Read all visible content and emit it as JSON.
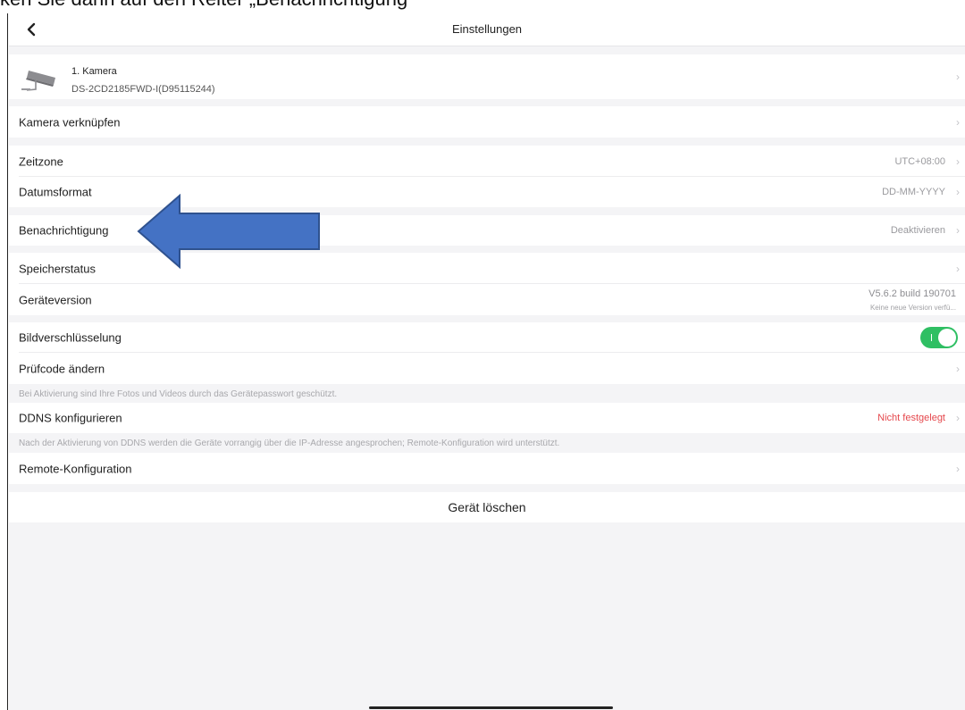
{
  "doc_caption": "ken Sie dann auf den Reiter „Benachrichtigung",
  "header": {
    "title": "Einstellungen"
  },
  "camera": {
    "name": "1. Kamera",
    "serial": "DS-2CD2185FWD-I(D95115244)"
  },
  "rows": {
    "link_camera": {
      "label": "Kamera verknüpfen"
    },
    "timezone": {
      "label": "Zeitzone",
      "value": "UTC+08:00"
    },
    "date_format": {
      "label": "Datumsformat",
      "value": "DD-MM-YYYY"
    },
    "notification": {
      "label": "Benachrichtigung",
      "value": "Deaktivieren"
    },
    "storage": {
      "label": "Speicherstatus"
    },
    "version": {
      "label": "Geräteversion",
      "value": "V5.6.2 build 190701",
      "sub": "Keine neue Version verfü..."
    },
    "encryption": {
      "label": "Bildverschlüsselung",
      "enabled": true
    },
    "verify_code": {
      "label": "Prüfcode ändern"
    },
    "ddns": {
      "label": "DDNS konfigurieren",
      "value": "Nicht festgelegt"
    },
    "remote": {
      "label": "Remote-Konfiguration"
    }
  },
  "notes": {
    "encryption": "Bei Aktivierung sind Ihre Fotos und Videos durch das Gerätepasswort geschützt.",
    "ddns": "Nach der Aktivierung von DDNS werden die Geräte vorrangig über die IP-Adresse angesprochen; Remote-Konfiguration wird unterstützt."
  },
  "delete_label": "Gerät löschen",
  "chevron": "›",
  "colors": {
    "toggle_on": "#2fbf63",
    "warning": "#e5484d",
    "arrow": "#4472c4",
    "arrow_stroke": "#2f528f"
  },
  "icons": {
    "back": "back-icon",
    "camera": "camera-icon",
    "chevron": "chevron-right-icon",
    "arrow": "arrow-left-icon"
  }
}
